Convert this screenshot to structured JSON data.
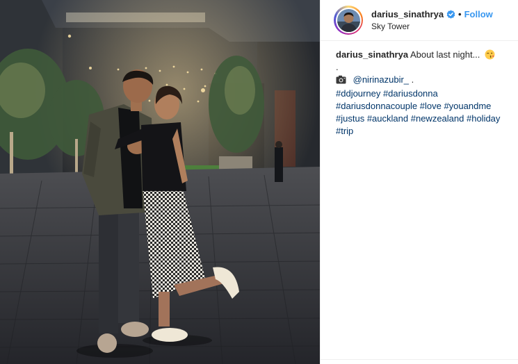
{
  "post": {
    "username": "darius_sinathrya",
    "follow_label": "Follow",
    "dot": "•",
    "location": "Sky Tower"
  },
  "caption": {
    "username": "darius_sinathrya",
    "text": "About last night...",
    "period": ".",
    "mention": "@nirinazubir_",
    "mention_suffix": " .",
    "hashtags_line1": [
      "#ddjourney",
      "#dariusdonna"
    ],
    "hashtags_line2": [
      "#dariusdonnacouple",
      "#love",
      "#youandme"
    ],
    "hashtags_line3": [
      "#justus",
      "#auckland",
      "#newzealand",
      "#holiday"
    ],
    "hashtags_line4": [
      "#trip"
    ]
  },
  "icons": {
    "verified": "verified-badge-icon",
    "emoji": "kissing-face-emoji-icon",
    "camera": "camera-icon"
  },
  "colors": {
    "follow_blue": "#3897f0",
    "hashtag_blue": "#003569",
    "verified_blue": "#3897f0"
  }
}
